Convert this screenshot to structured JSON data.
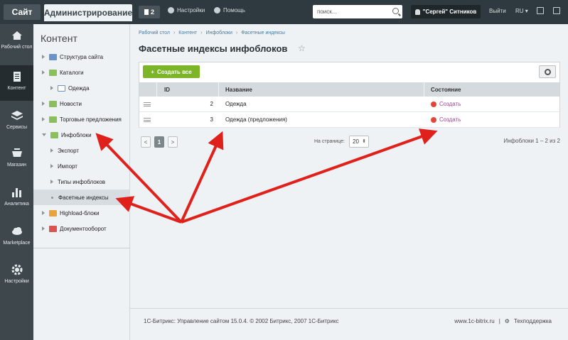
{
  "topbar": {
    "site_tab": "Сайт",
    "admin_tab": "Администрирование",
    "notifications_count": "2",
    "settings": "Настройки",
    "help": "Помощь",
    "search_placeholder": "поиск...",
    "user_name": "\"Сергей\" Ситников",
    "logout": "Выйти",
    "language": "RU ▾"
  },
  "iconbar": [
    {
      "label": "Рабочий стол",
      "icon": "desktop-icon"
    },
    {
      "label": "Контент",
      "icon": "content-icon",
      "active": true
    },
    {
      "label": "Сервисы",
      "icon": "services-icon"
    },
    {
      "label": "Магазин",
      "icon": "cart-icon"
    },
    {
      "label": "Аналитика",
      "icon": "analytics-icon"
    },
    {
      "label": "Marketplace",
      "icon": "cloud-icon"
    },
    {
      "label": "Настройки",
      "icon": "gear-icon"
    }
  ],
  "sidebar": {
    "title": "Контент",
    "items": [
      {
        "label": "Структура сайта"
      },
      {
        "label": "Каталоги"
      },
      {
        "label": "Одежда"
      },
      {
        "label": "Новости"
      },
      {
        "label": "Торговые предложения"
      },
      {
        "label": "Инфоблоки"
      },
      {
        "label": "Экспорт"
      },
      {
        "label": "Импорт"
      },
      {
        "label": "Типы инфоблоков"
      },
      {
        "label": "Фасетные индексы"
      },
      {
        "label": "Highload-блоки"
      },
      {
        "label": "Документооборот"
      }
    ]
  },
  "breadcrumb": [
    "Рабочий стол",
    "Контент",
    "Инфоблоки",
    "Фасетные индексы"
  ],
  "page_title": "Фасетные индексы инфоблоков",
  "toolbar": {
    "create_all": "Создать все"
  },
  "table": {
    "columns": [
      "ID",
      "Название",
      "Состояние"
    ],
    "rows": [
      {
        "id": "2",
        "name": "Одежда",
        "status": "Создать"
      },
      {
        "id": "3",
        "name": "Одежда (предложения)",
        "status": "Создать"
      }
    ]
  },
  "pagination": {
    "prev": "<",
    "current": "1",
    "next": ">",
    "per_page_label": "На странице:",
    "per_page_value": "20",
    "count": "Инфоблоки 1 – 2 из 2"
  },
  "footer": {
    "copyright": "1С-Битрикс: Управление сайтом 15.0.4. © 2002 Битрикс, 2007 1С-Битрикс",
    "site_link": "www.1c-bitrix.ru",
    "separator": "|",
    "support": "Техподдержка"
  },
  "colors": {
    "accent_green": "#7cb527",
    "annotation_red": "#e0201b",
    "status_red": "#e0473b"
  }
}
